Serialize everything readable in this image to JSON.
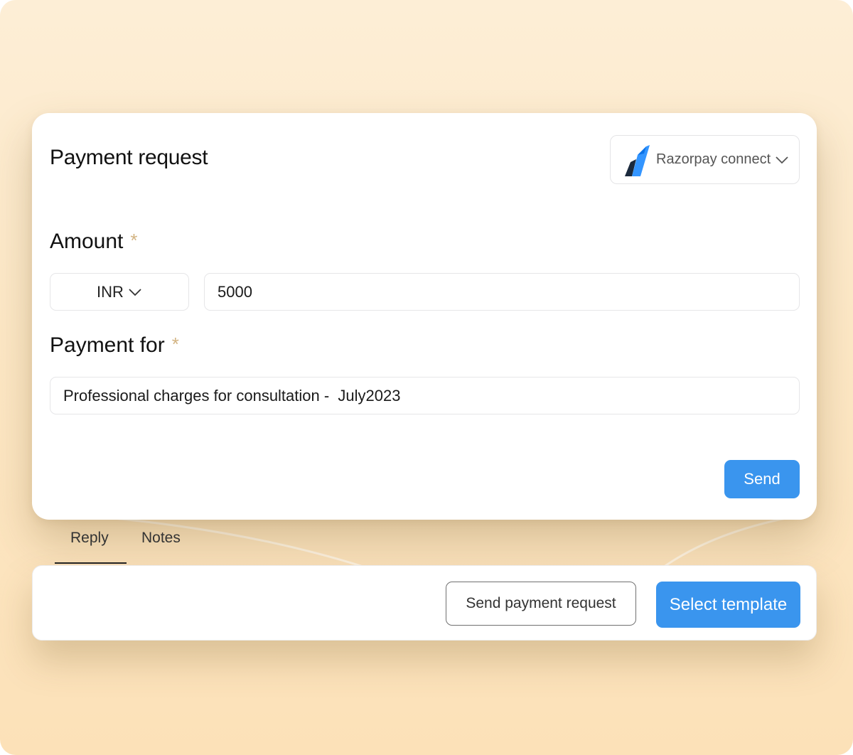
{
  "header": {
    "title": "Payment request",
    "gateway": {
      "label": "Razorpay connect",
      "logo_icon": "razorpay-logo-icon",
      "dropdown_icon": "chevron-down-icon"
    }
  },
  "form": {
    "amount_label": "Amount",
    "required_mark": "*",
    "currency": "INR",
    "amount_value": "5000",
    "payment_for_label": "Payment for",
    "payment_for_value": "Professional charges for consultation -  July2023",
    "send_label": "Send"
  },
  "tabs": [
    {
      "label": "Reply",
      "active": true
    },
    {
      "label": "Notes",
      "active": false
    }
  ],
  "composer": {
    "send_payment_request_label": "Send payment request",
    "select_template_label": "Select template"
  },
  "colors": {
    "accent": "#3a95ee",
    "required": "#d3b483",
    "background": "#fde8c6"
  }
}
